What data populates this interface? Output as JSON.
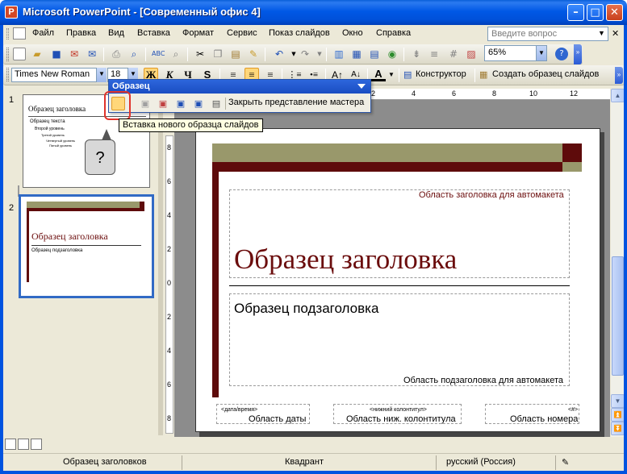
{
  "window": {
    "title": "Microsoft PowerPoint - [Современный офис 4]",
    "app_icon_letter": "P"
  },
  "menu": {
    "items": [
      "Файл",
      "Правка",
      "Вид",
      "Вставка",
      "Формат",
      "Сервис",
      "Показ слайдов",
      "Окно",
      "Справка"
    ],
    "help_placeholder": "Введите вопрос"
  },
  "standard_toolbar": {
    "zoom": "65%"
  },
  "format_toolbar": {
    "font": "Times New Roman",
    "size": "18",
    "bold": "Ж",
    "italic": "К",
    "underline": "Ч",
    "shadow": "S",
    "designer_label": "Конструктор",
    "new_master_label": "Создать образец слайдов"
  },
  "master_toolbar": {
    "title": "Образец",
    "close_label": "Закрыть представление мастера",
    "tooltip": "Вставка нового образца слайдов",
    "callout": "?"
  },
  "slides_pane": {
    "slide1_number": "1",
    "slide2_number": "2",
    "thumb1_title": "Образец заголовка",
    "thumb1_text": "Образец текста",
    "thumb1_level2": "Второй уровень",
    "thumb1_level3": "Третий уровень",
    "thumb1_level4": "Четвертый уровень",
    "thumb1_level5": "Пятый уровень",
    "thumb2_title": "Образец заголовка",
    "thumb2_subtitle": "Образец подзаголовка"
  },
  "ruler": {
    "top_marks": [
      "2",
      "4",
      "6",
      "8",
      "10",
      "12"
    ],
    "left_marks": [
      "8",
      "6",
      "4",
      "2",
      "0",
      "2",
      "4",
      "6",
      "8"
    ]
  },
  "slide": {
    "title_area_label": "Область заголовка для автомакета",
    "title": "Образец заголовка",
    "subtitle": "Образец подзаголовка",
    "subtitle_area_label": "Область подзаголовка для автомакета",
    "date_small": "<дата/время>",
    "date_label": "Область даты",
    "footer_small": "<нижний колонтитул>",
    "footer_label": "Область ниж. колонтитула",
    "number_small": "<#>",
    "number_label": "Область номера"
  },
  "status": {
    "left": "Образец заголовков",
    "middle": "Квадрант",
    "right": "русский (Россия)"
  },
  "colors": {
    "title_bar": "#0058e6",
    "maroon": "#5e0b0b",
    "olive": "#99986b",
    "title_text": "#6b0d0d",
    "highlight": "#e0342c"
  }
}
